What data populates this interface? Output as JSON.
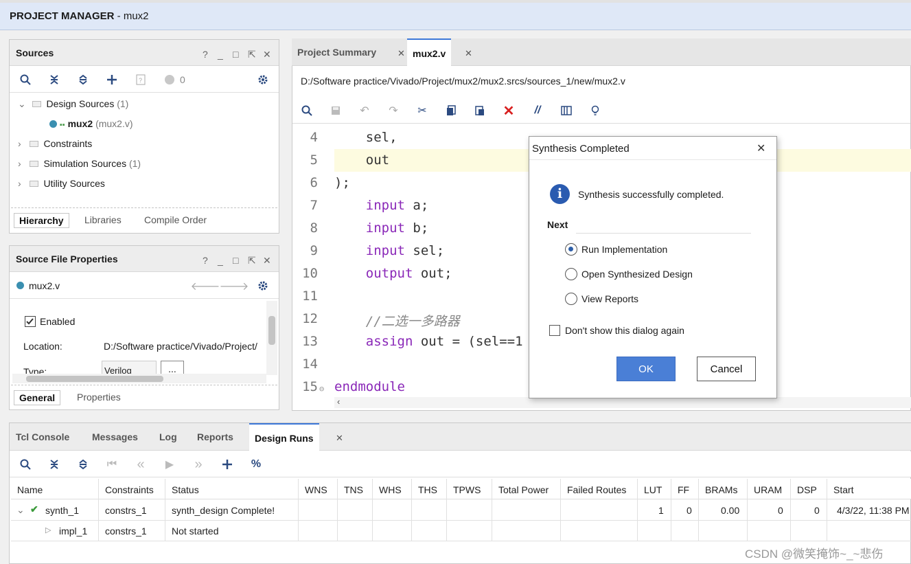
{
  "topbar": {
    "title_bold": "PROJECT MANAGER",
    "title_rest": " - mux2"
  },
  "sources": {
    "title": "Sources",
    "controls": [
      "?",
      "_",
      "□",
      "⇱",
      "✕"
    ],
    "status_count": "0",
    "tree": [
      {
        "label": "Design Sources",
        "count": "(1)"
      },
      {
        "label": "mux2",
        "sub": "(mux2.v)"
      },
      {
        "label": "Constraints",
        "count": ""
      },
      {
        "label": "Simulation Sources",
        "count": "(1)"
      },
      {
        "label": "Utility Sources",
        "count": ""
      }
    ],
    "tabs": [
      "Hierarchy",
      "Libraries",
      "Compile Order"
    ]
  },
  "props": {
    "title": "Source File Properties",
    "file": "mux2.v",
    "enabled_label": "Enabled",
    "location_label": "Location:",
    "location_value": "D:/Software practice/Vivado/Project/",
    "type_label": "Type:",
    "type_value": "Verilog",
    "more": "...",
    "tabs": [
      "General",
      "Properties"
    ]
  },
  "editor": {
    "tabs": [
      "Project Summary",
      "mux2.v"
    ],
    "path": "D:/Software practice/Vivado/Project/mux2/mux2.srcs/sources_1/new/mux2.v",
    "lines": [
      {
        "n": "4",
        "code": "    sel,",
        "kind": "plain"
      },
      {
        "n": "5",
        "code": "    out",
        "kind": "plain"
      },
      {
        "n": "6",
        "code": ");",
        "kind": "plain"
      },
      {
        "n": "7",
        "kw": "    input",
        "rest": " a;",
        "kind": "kw"
      },
      {
        "n": "8",
        "kw": "    input",
        "rest": " b;",
        "kind": "kw"
      },
      {
        "n": "9",
        "kw": "    input",
        "rest": " sel;",
        "kind": "kw"
      },
      {
        "n": "10",
        "kw": "    output",
        "rest": " out;",
        "kind": "kw"
      },
      {
        "n": "11",
        "code": "",
        "kind": "plain"
      },
      {
        "n": "12",
        "code": "    //二选一多路器",
        "kind": "comment"
      },
      {
        "n": "13",
        "kw": "    assign",
        "rest": " out = (sel==1",
        "kind": "kw"
      },
      {
        "n": "14",
        "code": "",
        "kind": "plain"
      },
      {
        "n": "15",
        "kw": "endmodule",
        "rest": "",
        "kind": "kw"
      }
    ]
  },
  "dialog": {
    "title": "Synthesis Completed",
    "message": "Synthesis successfully completed.",
    "next_label": "Next",
    "options": [
      "Run Implementation",
      "Open Synthesized Design",
      "View Reports"
    ],
    "checkbox": "Don't show this dialog again",
    "ok": "OK",
    "cancel": "Cancel"
  },
  "bottom": {
    "tabs": [
      "Tcl Console",
      "Messages",
      "Log",
      "Reports",
      "Design Runs"
    ],
    "columns": [
      "Name",
      "Constraints",
      "Status",
      "WNS",
      "TNS",
      "WHS",
      "THS",
      "TPWS",
      "Total Power",
      "Failed Routes",
      "LUT",
      "FF",
      "BRAMs",
      "URAM",
      "DSP",
      "Start"
    ],
    "rows": [
      {
        "name": "synth_1",
        "constraints": "constrs_1",
        "status": "synth_design Complete!",
        "lut": "1",
        "ff": "0",
        "brams": "0.00",
        "uram": "0",
        "dsp": "0",
        "start": "4/3/22, 11:38 PM"
      },
      {
        "name": "impl_1",
        "constraints": "constrs_1",
        "status": "Not started"
      }
    ]
  },
  "watermark": "CSDN @微笑掩饰~_~悲伤",
  "colors": {
    "accent": "#3c78d8",
    "ok_button": "#4a7fd6",
    "highlight_line": "#fdfbe0",
    "keyword": "#8a28b8"
  }
}
